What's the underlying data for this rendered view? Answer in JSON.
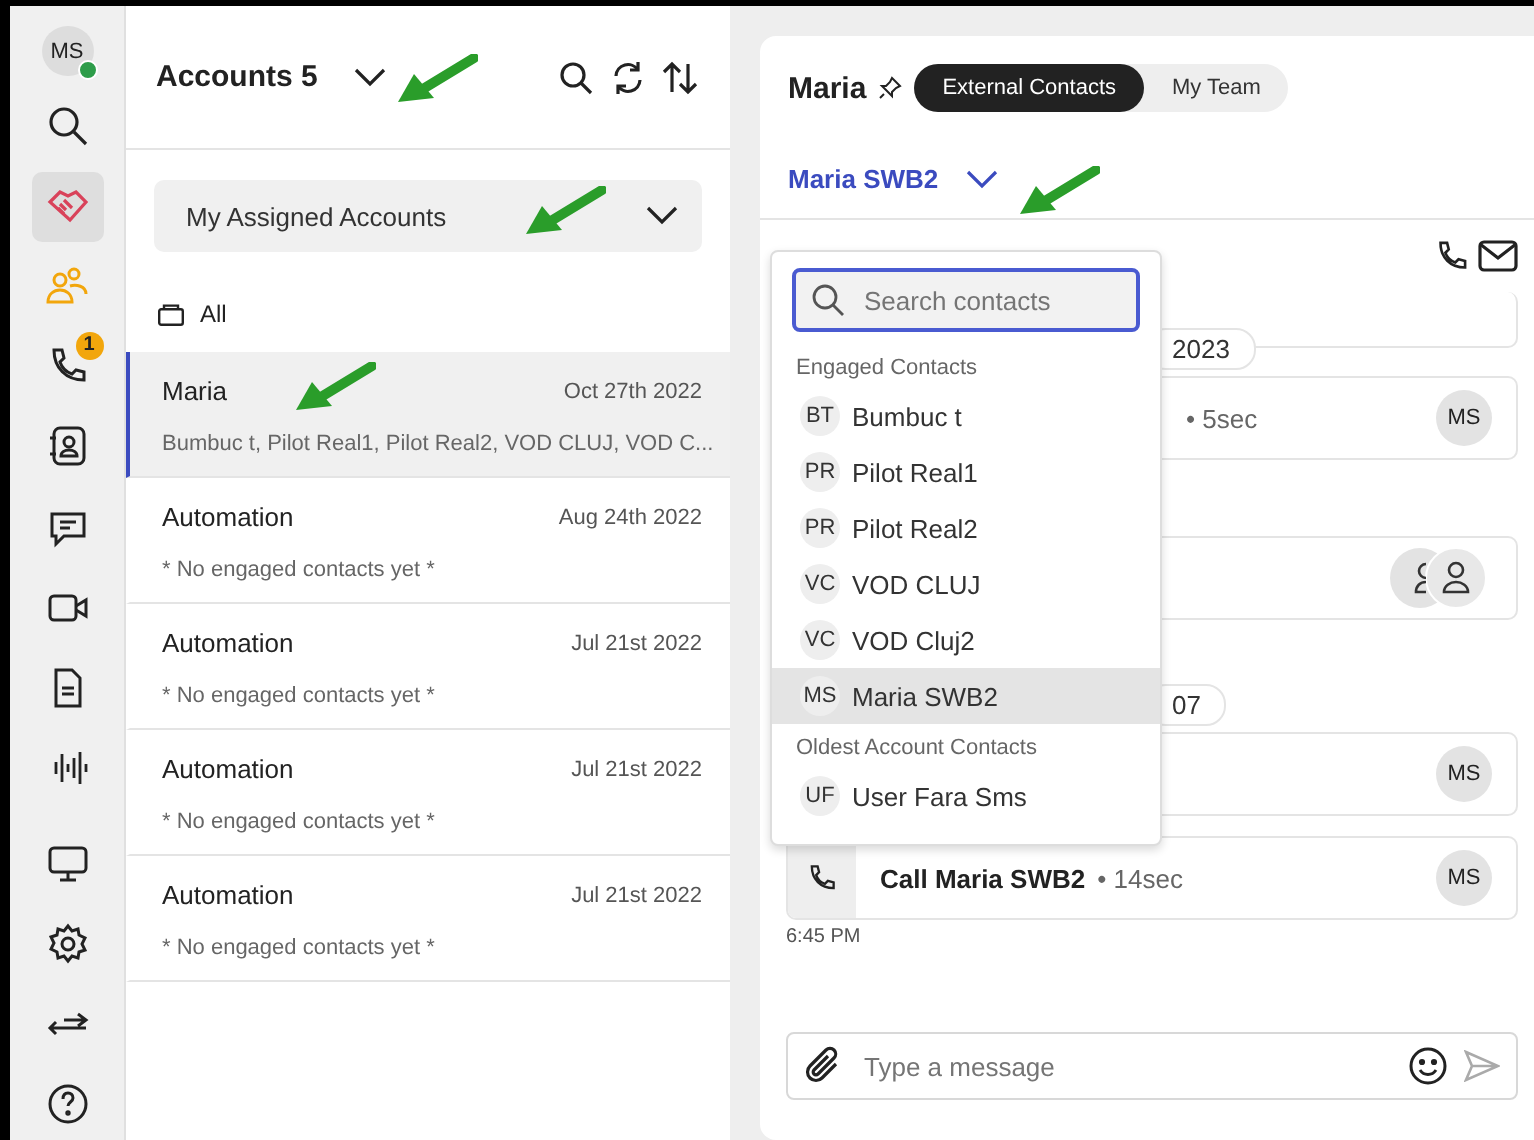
{
  "rail": {
    "avatar": "MS",
    "online": true,
    "items": [
      {
        "selected": false
      },
      {
        "selected": true
      },
      {
        "selected": false
      },
      {
        "selected": false,
        "badge": "1"
      },
      {
        "selected": false
      },
      {
        "selected": false
      },
      {
        "selected": false
      },
      {
        "selected": false
      },
      {
        "selected": false
      },
      {
        "selected": false
      },
      {
        "selected": false
      },
      {
        "selected": false
      },
      {
        "selected": false
      }
    ]
  },
  "accounts": {
    "title": "Accounts 5",
    "filter": "My Assigned Accounts",
    "folder": "All",
    "rows": [
      {
        "name": "Maria",
        "date": "Oct 27th 2022",
        "contacts": "Bumbuc t, Pilot Real1, Pilot Real2, VOD CLUJ, VOD C...",
        "selected": true
      },
      {
        "name": "Automation",
        "date": "Aug 24th 2022",
        "contacts": "* No engaged contacts yet *",
        "selected": false
      },
      {
        "name": "Automation",
        "date": "Jul 21st 2022",
        "contacts": "* No engaged contacts yet *",
        "selected": false
      },
      {
        "name": "Automation",
        "date": "Jul 21st 2022",
        "contacts": "* No engaged contacts yet *",
        "selected": false
      },
      {
        "name": "Automation",
        "date": "Jul 21st 2022",
        "contacts": "* No engaged contacts yet *",
        "selected": false
      }
    ]
  },
  "detail": {
    "title": "Maria",
    "tabs": [
      {
        "label": "External Contacts",
        "selected": true
      },
      {
        "label": "My Team",
        "selected": false
      }
    ],
    "contact": "Maria SWB2",
    "timeline": [
      {
        "kind": "blank"
      },
      {
        "kind": "pill",
        "text": "2023"
      },
      {
        "kind": "card",
        "text": "• 5sec",
        "avatar": "MS"
      },
      {
        "kind": "group"
      },
      {
        "kind": "pill",
        "text": "07"
      },
      {
        "kind": "card",
        "avatar": "MS"
      },
      {
        "kind": "call",
        "title": "Call Maria SWB2",
        "text": "• 14sec",
        "avatar": "MS"
      },
      {
        "kind": "time",
        "text": "6:45 PM"
      }
    ],
    "composer": {
      "placeholder": "Type a message"
    }
  },
  "contact_menu": {
    "placeholder": "Search contacts",
    "groups": [
      {
        "title": "Engaged Contacts",
        "contacts": [
          {
            "initials": "BT",
            "name": "Bumbuc t",
            "selected": false
          },
          {
            "initials": "PR",
            "name": "Pilot Real1",
            "selected": false
          },
          {
            "initials": "PR",
            "name": "Pilot Real2",
            "selected": false
          },
          {
            "initials": "VC",
            "name": "VOD CLUJ",
            "selected": false
          },
          {
            "initials": "VC",
            "name": "VOD Cluj2",
            "selected": false
          },
          {
            "initials": "MS",
            "name": "Maria SWB2",
            "selected": true
          }
        ]
      },
      {
        "title": "Oldest Account Contacts",
        "contacts": [
          {
            "initials": "UF",
            "name": "User Fara Sms",
            "selected": false
          }
        ]
      }
    ]
  }
}
